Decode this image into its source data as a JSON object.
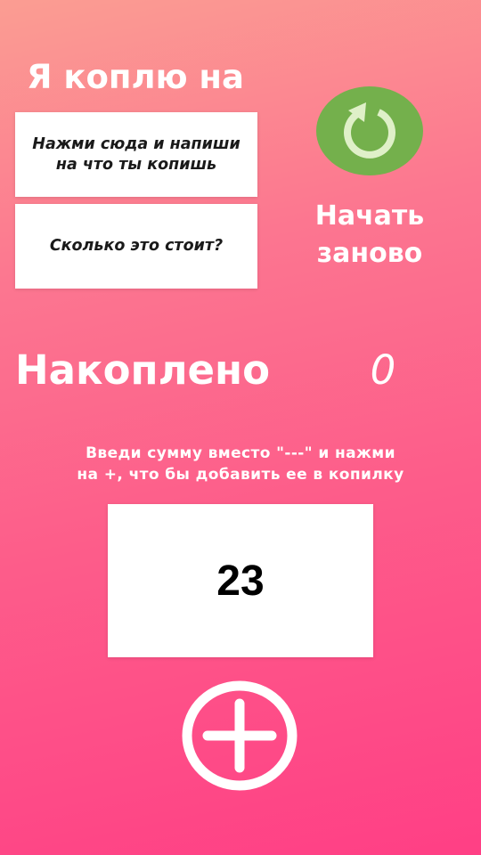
{
  "title": "Я коплю на",
  "goal_input": {
    "placeholder": "Нажми сюда и напиши на что ты копишь"
  },
  "price_input": {
    "placeholder": "Сколько это стоит?"
  },
  "restart": {
    "label": "Начать заново",
    "icon": "refresh-icon",
    "color": "#74b04c"
  },
  "saved": {
    "label": "Накоплено",
    "value": "0"
  },
  "instruction": "Введи сумму вместо \"---\" и нажми\nна +, что бы добавить ее в копилку",
  "amount_input": {
    "value": "23"
  },
  "add_button": {
    "icon": "plus-circle-icon"
  }
}
